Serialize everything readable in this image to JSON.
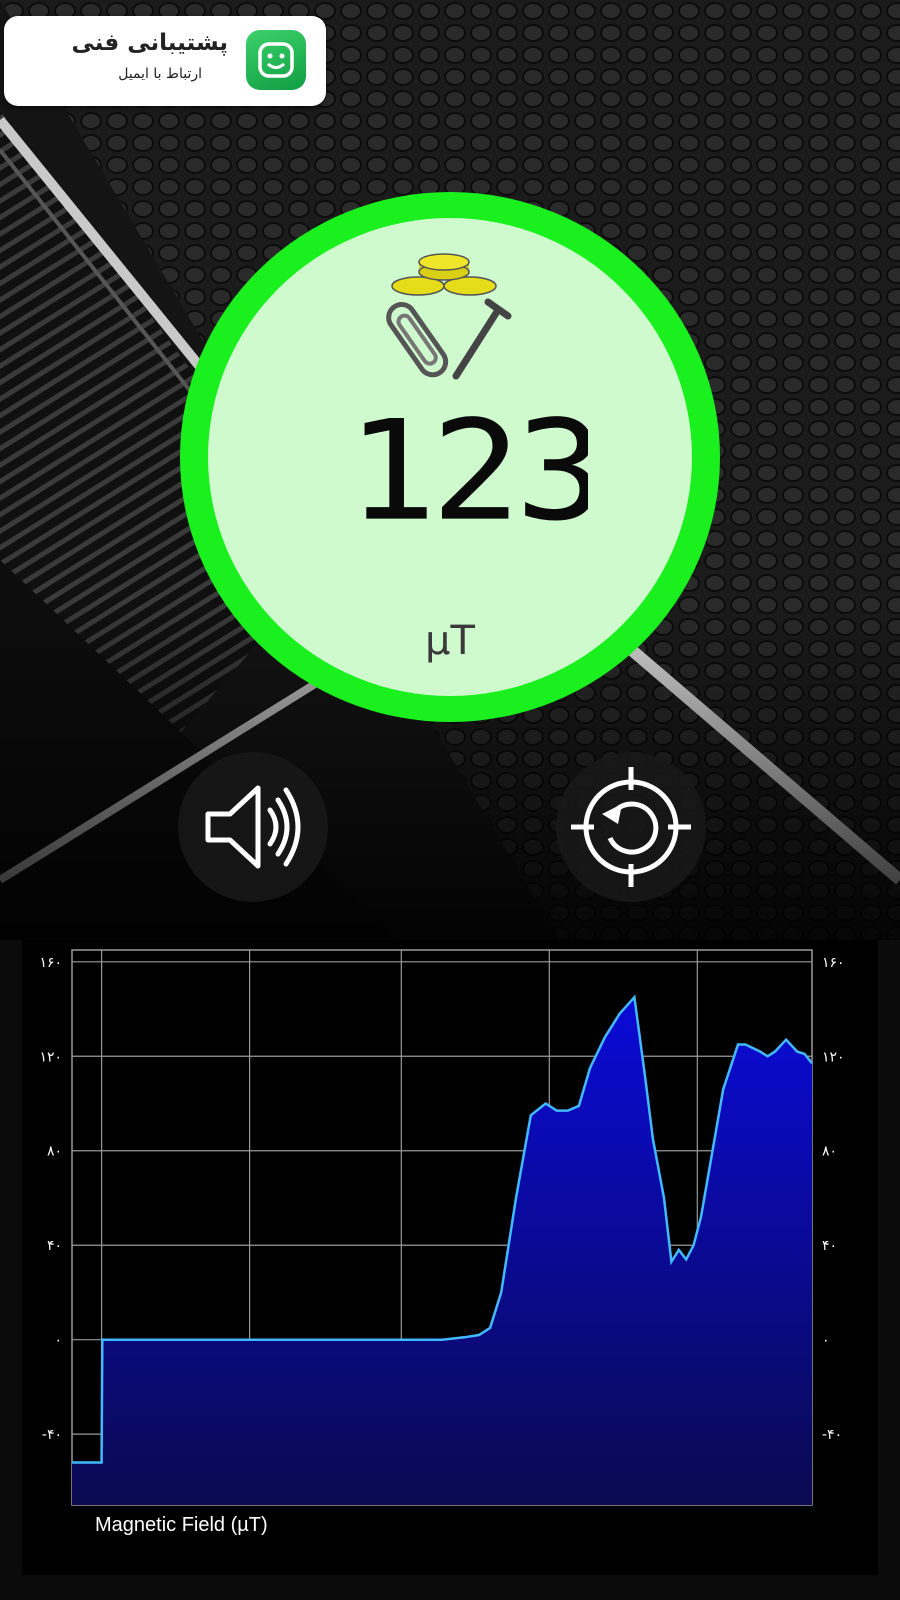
{
  "support": {
    "title": "پشتیبانی فنی",
    "subtitle": "ارتباط با ایمیل"
  },
  "meter": {
    "value": "123",
    "unit": "µT",
    "ring_color": "#19f01e",
    "face_color": "#cefacd"
  },
  "controls": {
    "sound_icon": "speaker-icon",
    "calibrate_icon": "reset-crosshair-icon"
  },
  "chart_data": {
    "type": "area",
    "caption": "Magnetic Field (µT)",
    "y_ticks": [
      "۱۶۰",
      "۱۲۰",
      "۸۰",
      "۴۰",
      "۰",
      "-۴۰"
    ],
    "y_tick_values": [
      160,
      120,
      80,
      40,
      0,
      -40
    ],
    "ylim": [
      -70,
      165
    ],
    "xlim": [
      0,
      100
    ],
    "grid": true,
    "line_color": "#42b9ff",
    "fill_color": "#0a0ad8",
    "x": [
      0,
      4,
      4.1,
      6,
      10,
      14,
      18,
      22,
      26,
      30,
      34,
      38,
      42,
      46,
      50,
      53,
      55,
      56.5,
      58,
      60,
      62,
      64,
      65.5,
      67,
      68.5,
      70,
      72,
      74,
      76,
      77.5,
      78.5,
      80,
      81,
      82,
      83,
      84,
      85,
      86,
      87,
      88,
      90,
      91,
      93,
      94,
      95,
      96.5,
      98,
      99,
      100
    ],
    "values": [
      -52,
      -52,
      0,
      0,
      0,
      0,
      0,
      0,
      0,
      0,
      0,
      0,
      0,
      0,
      0,
      1,
      2,
      5,
      20,
      60,
      95,
      100,
      97,
      97,
      99,
      115,
      128,
      138,
      145,
      110,
      85,
      60,
      33,
      38,
      34,
      40,
      52,
      70,
      88,
      106,
      125,
      125,
      122,
      120,
      122,
      127,
      122,
      121,
      117
    ]
  }
}
